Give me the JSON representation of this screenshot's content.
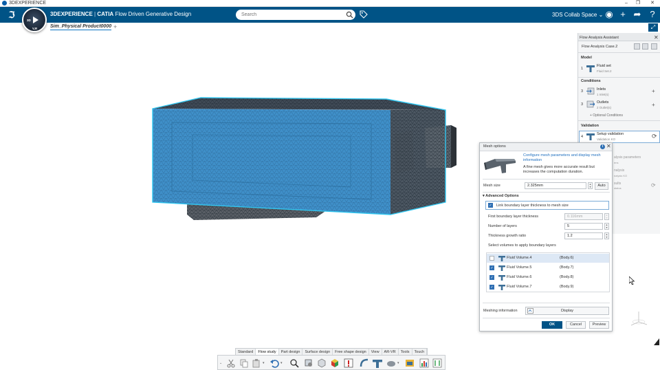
{
  "os": {
    "title": "3DEXPERIENCE"
  },
  "app": {
    "brand_main": "3DEXPERIENCE",
    "brand_sep": "|",
    "brand_app": "CATIA",
    "brand_role": "Flow Driven Generative Design",
    "compass_left": "3D",
    "compass_bottom": "V,R"
  },
  "search": {
    "placeholder": "Search"
  },
  "collab": {
    "space": "3DS Collab Space"
  },
  "tabs": {
    "document": "Sim_Physical Product0000",
    "add": "+"
  },
  "assistant": {
    "title": "Flow Analysis Assistant",
    "case": "Flow Analysis Case.2",
    "model_header": "Model",
    "fluid_num": "1",
    "fluid_title": "Fluid set",
    "fluid_sub": "Fluid Set.2",
    "conditions_header": "Conditions",
    "inlets_num": "3",
    "inlets_title": "Inlets",
    "inlets_sub": "1 Inlet(s)",
    "outlets_num": "3",
    "outlets_title": "Outlets",
    "outlets_sub": "2 Outlet(s)",
    "optional": "+ Optional Conditions",
    "validation_header": "Validation",
    "setup_num": "4",
    "setup_title": "Setup validation",
    "setup_sub": "Validation KO",
    "ghost_1": "alysis parameters",
    "ghost_2": "ens",
    "ghost_3": "nalysis",
    "ghost_4": "nalysis KO",
    "ghost_5": "sults",
    "ghost_6": "status"
  },
  "mesh": {
    "title": "Mesh options",
    "link": "Configure mesh parameters and display mesh information",
    "desc": "A fine mesh gives more accurate result but increases the computation duration.",
    "mesh_size_label": "Mesh size",
    "mesh_size_value": "2.325mm",
    "auto": "Auto",
    "advanced": "Advanced Options",
    "link_boundary": "Link boundary layer thickness to mesh size",
    "first_layer_label": "First boundary layer thickness",
    "first_layer_value": "0.116mm",
    "num_layers_label": "Number of layers",
    "num_layers_value": "5",
    "growth_label": "Thickness growth ratio",
    "growth_value": "1.2",
    "volumes_label": "Select volumes to apply boundary layers",
    "volumes": [
      {
        "name": "Fluid Volume.4",
        "body": "(Body.6)",
        "checked": false
      },
      {
        "name": "Fluid Volume.5",
        "body": "(Body.7)",
        "checked": true
      },
      {
        "name": "Fluid Volume.6",
        "body": "(Body.8)",
        "checked": true
      },
      {
        "name": "Fluid Volume.7",
        "body": "(Body.9)",
        "checked": true
      }
    ],
    "meshing_info_label": "Meshing information",
    "display": "Display",
    "ok": "OK",
    "cancel": "Cancel",
    "preview": "Preview"
  },
  "toolbar": {
    "tabs": [
      "Standard",
      "Flow study",
      "Part design",
      "Surface design",
      "Free shape design",
      "View",
      "AR-VR",
      "Tools",
      "Touch"
    ],
    "active_tab": "Flow study"
  },
  "colors": {
    "accent": "#005386",
    "mesh_blue": "#3f8fc8",
    "selection_cyan": "#31c6f0"
  }
}
